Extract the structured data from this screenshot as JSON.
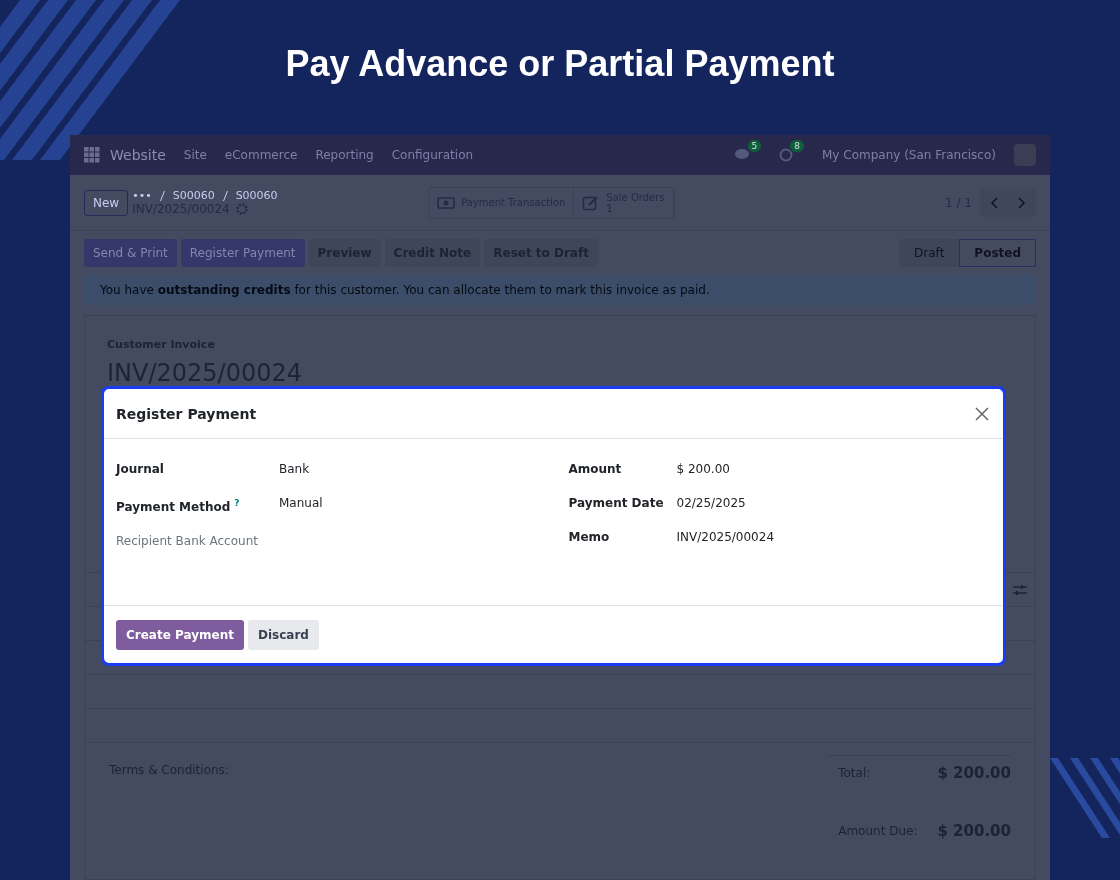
{
  "title": "Pay Advance or Partial Payment",
  "navbar": {
    "app_name": "Website",
    "menu": [
      "Site",
      "eCommerce",
      "Reporting",
      "Configuration"
    ],
    "messages_badge": "5",
    "activities_badge": "8",
    "company": "My Company (San Francisco)"
  },
  "control_panel": {
    "new_button": "New",
    "breadcrumbs": [
      "•••",
      "S00060",
      "S00060"
    ],
    "record_name": "INV/2025/00024",
    "smart_buttons": [
      {
        "kind": "payment",
        "label": "Payment Transaction"
      },
      {
        "kind": "orders",
        "label": "Sale Orders",
        "count": "1"
      }
    ],
    "pager": "1 / 1"
  },
  "action_buttons": [
    {
      "label": "Send & Print",
      "primary": true
    },
    {
      "label": "Register Payment",
      "primary": true
    },
    {
      "label": "Preview",
      "primary": false
    },
    {
      "label": "Credit Note",
      "primary": false
    },
    {
      "label": "Reset to Draft",
      "primary": false
    }
  ],
  "statusbar": [
    {
      "label": "Draft",
      "selected": false
    },
    {
      "label": "Posted",
      "selected": true
    }
  ],
  "alert": "You have **outstanding credits** for this customer. You can allocate them to mark this invoice as paid.",
  "sheet": {
    "type_label": "Customer Invoice",
    "invoice_number": "INV/2025/00024",
    "terms_label": "Terms & Conditions:",
    "total_label": "Total:",
    "total_value": "$ 200.00",
    "amount_due_label": "Amount Due:",
    "amount_due_value": "$ 200.00"
  },
  "modal": {
    "title": "Register Payment",
    "left_fields": [
      {
        "label": "Journal",
        "value": "Bank",
        "muted": false
      },
      {
        "label": "Payment Method",
        "value": "Manual",
        "help": "?",
        "muted": false
      },
      {
        "label": "Recipient Bank Account",
        "muted": true
      }
    ],
    "right_fields": [
      {
        "label": "Amount",
        "value": "$ 200.00",
        "muted": false
      },
      {
        "label": "Payment Date",
        "value": "02/25/2025",
        "muted": false
      },
      {
        "label": "Memo",
        "value": "INV/2025/00024",
        "muted": false
      }
    ],
    "buttons": [
      {
        "label": "Create Payment",
        "primary": true
      },
      {
        "label": "Discard",
        "primary": false
      }
    ]
  }
}
